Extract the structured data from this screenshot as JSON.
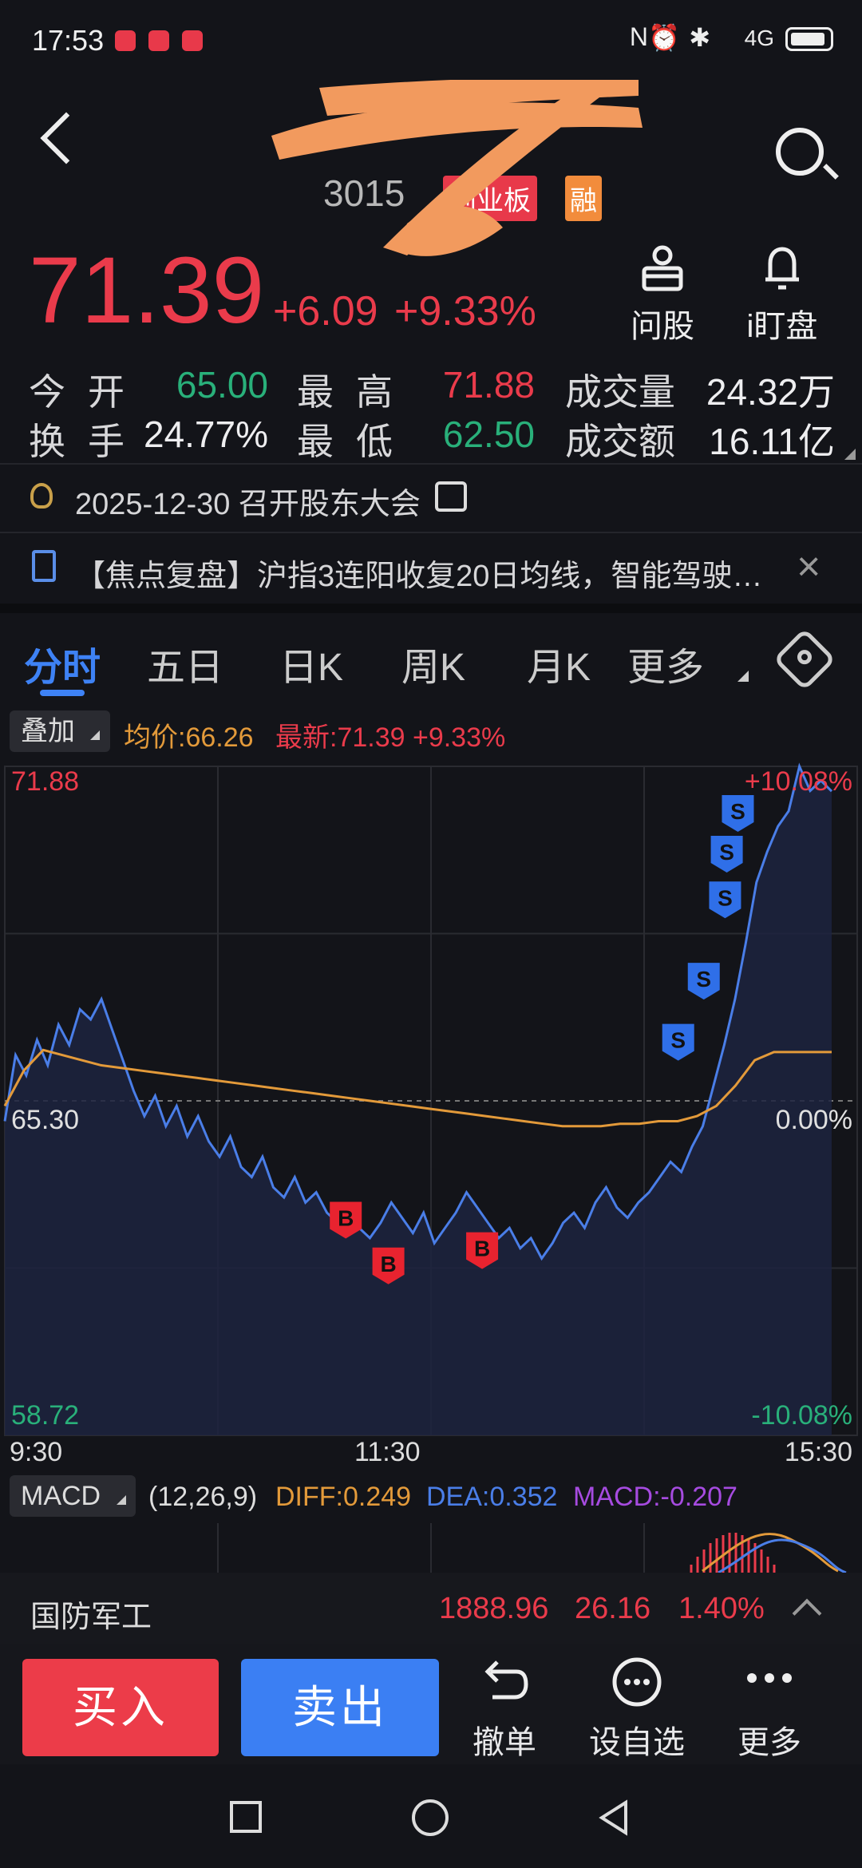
{
  "status": {
    "time": "17:53",
    "network": "4G"
  },
  "header": {
    "code_prefix": "3015",
    "board_tag": "创业板",
    "margin_tag": "融",
    "ask_label": "问股",
    "watch_label": "i盯盘"
  },
  "quote": {
    "price": "71.39",
    "change": "+6.09",
    "change_pct": "+9.33%",
    "open_label": "今开",
    "open": "65.00",
    "high_label": "最高",
    "high": "71.88",
    "volume_label": "成交量",
    "volume": "24.32万",
    "turnover_label": "换手",
    "turnover": "24.77%",
    "low_label": "最低",
    "low": "62.50",
    "amount_label": "成交额",
    "amount": "16.11亿"
  },
  "notice": {
    "text": "2025-12-30 召开股东大会"
  },
  "news": {
    "text": "【焦点复盘】沪指3连阳收复20日均线，智能驾驶…"
  },
  "tabs": [
    "分时",
    "五日",
    "日K",
    "周K",
    "月K",
    "更多"
  ],
  "overlay": {
    "button": "叠加",
    "avg_price": "均价:66.26",
    "latest": "最新:71.39 +9.33%"
  },
  "chart_data": {
    "type": "line",
    "title": "",
    "y_left_labels": [
      "71.88",
      "65.30",
      "58.72"
    ],
    "y_right_labels": [
      "+10.08%",
      "0.00%",
      "-10.08%"
    ],
    "x_labels": [
      "9:30",
      "11:30",
      "15:30"
    ],
    "ylim": [
      58.72,
      71.88
    ],
    "prev_close": 65.3,
    "series": [
      {
        "values": [
          64.9,
          66.2,
          65.8,
          66.5,
          66.0,
          66.8,
          66.4,
          67.1,
          66.9,
          67.3,
          66.7,
          66.1,
          65.5,
          65.0,
          65.4,
          64.8,
          65.2,
          64.6,
          65.0,
          64.5,
          64.2,
          64.6,
          64.0,
          63.8,
          64.2,
          63.6,
          63.4,
          63.8,
          63.3,
          63.5,
          63.1,
          62.9,
          63.2,
          62.8,
          62.6,
          62.9,
          63.3,
          63.0,
          62.7,
          63.1,
          62.5,
          62.8,
          63.1,
          63.5,
          63.2,
          62.9,
          62.6,
          62.8,
          62.4,
          62.6,
          62.2,
          62.5,
          62.9,
          63.1,
          62.8,
          63.3,
          63.6,
          63.2,
          63.0,
          63.3,
          63.5,
          63.8,
          64.1,
          63.9,
          64.4,
          64.8,
          65.6,
          66.4,
          67.3,
          68.4,
          69.6,
          70.2,
          70.7,
          71.0,
          71.88,
          71.4,
          71.6,
          71.39
        ],
        "color": "#4a7ee8"
      },
      {
        "values": [
          65.2,
          65.9,
          66.3,
          66.2,
          66.1,
          66.0,
          65.95,
          65.9,
          65.85,
          65.8,
          65.75,
          65.7,
          65.65,
          65.6,
          65.55,
          65.5,
          65.45,
          65.4,
          65.35,
          65.3,
          65.25,
          65.2,
          65.15,
          65.1,
          65.05,
          65.0,
          64.95,
          64.9,
          64.85,
          64.8,
          64.8,
          64.8,
          64.85,
          64.85,
          64.9,
          64.9,
          65.0,
          65.2,
          65.6,
          66.1,
          66.26,
          66.26,
          66.26,
          66.26
        ],
        "color": "#e39a3a"
      }
    ],
    "markers": {
      "buy": [
        {
          "x": 0.4,
          "y": 63.0
        },
        {
          "x": 0.45,
          "y": 62.1
        },
        {
          "x": 0.56,
          "y": 62.4
        }
      ],
      "sell": [
        {
          "x": 0.79,
          "y": 66.5
        },
        {
          "x": 0.82,
          "y": 67.7
        },
        {
          "x": 0.845,
          "y": 69.3
        },
        {
          "x": 0.847,
          "y": 70.2
        },
        {
          "x": 0.86,
          "y": 71.0
        }
      ]
    }
  },
  "macd": {
    "button": "MACD",
    "params": "(12,26,9)",
    "diff": "DIFF:0.249",
    "dea": "DEA:0.352",
    "macd": "MACD:-0.207"
  },
  "sector": {
    "name": "国防军工",
    "value": "1888.96",
    "change": "26.16",
    "change_pct": "1.40%"
  },
  "actions": {
    "buy": "买入",
    "sell": "卖出",
    "cancel": "撤单",
    "watchlist": "设自选",
    "more": "更多"
  },
  "colors": {
    "up": "#ea3b4b",
    "down": "#29b07a",
    "accent": "#3e82f5",
    "avg_line": "#e39a3a"
  }
}
